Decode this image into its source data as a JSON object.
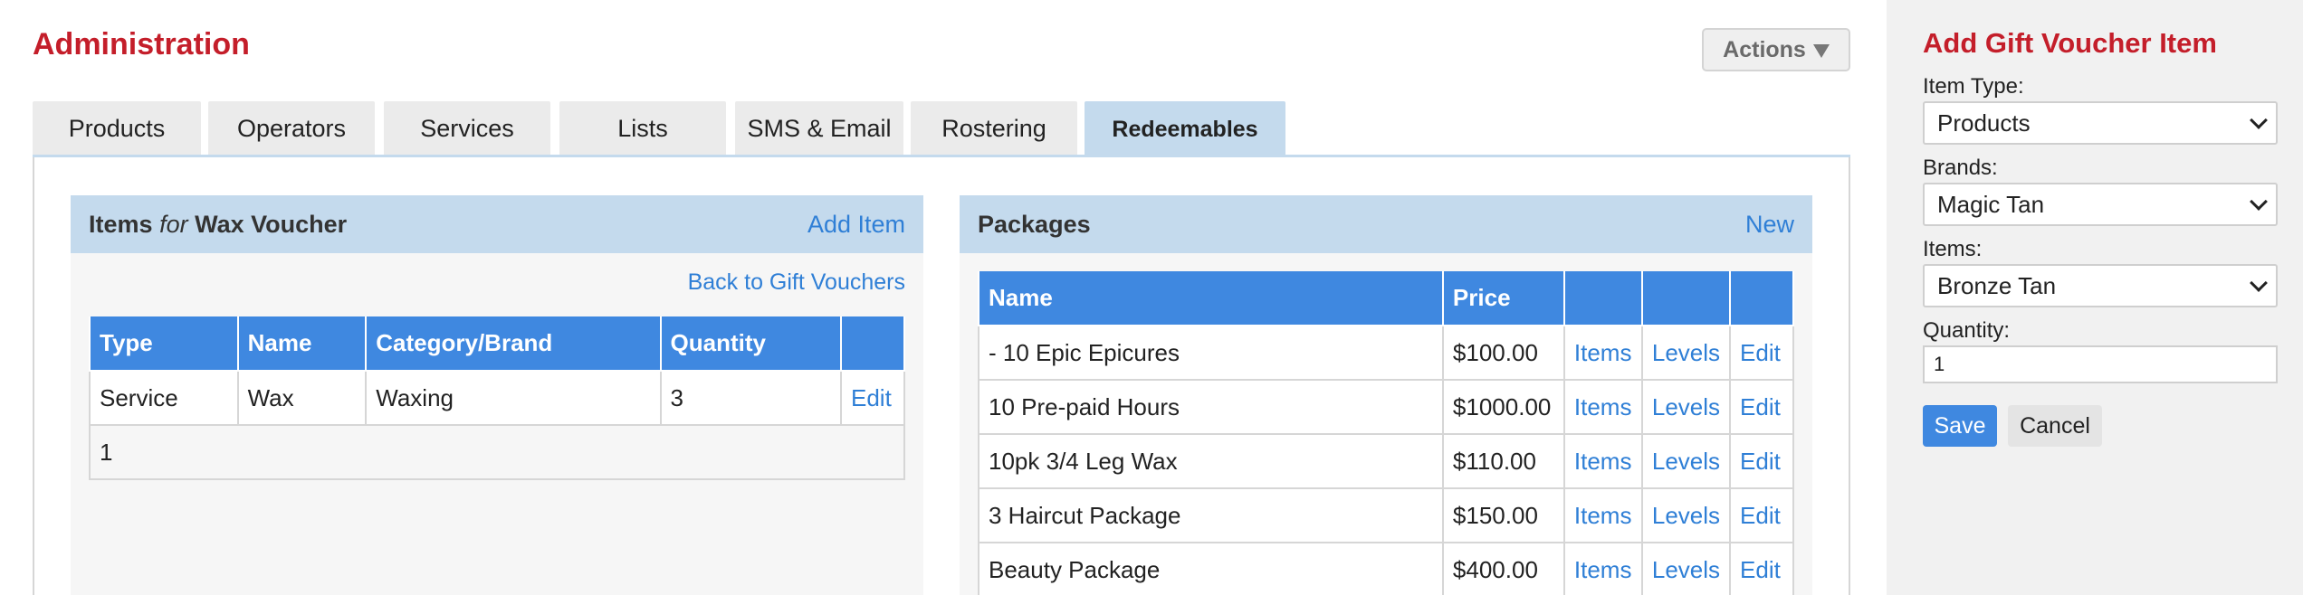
{
  "header": {
    "title": "Administration",
    "actions_label": "Actions"
  },
  "tabs": [
    {
      "label": "Products"
    },
    {
      "label": "Operators"
    },
    {
      "label": "Services"
    },
    {
      "label": "Lists"
    },
    {
      "label": "SMS & Email"
    },
    {
      "label": "Rostering"
    },
    {
      "label": "Redeemables",
      "active": true
    }
  ],
  "items_panel": {
    "title_prefix": "Items",
    "title_for": "for",
    "title_name": "Wax Voucher",
    "add_link": "Add Item",
    "back_link": "Back to Gift Vouchers",
    "columns": [
      "Type",
      "Name",
      "Category/Brand",
      "Quantity",
      ""
    ],
    "rows": [
      {
        "type": "Service",
        "name": "Wax",
        "category": "Waxing",
        "quantity": "3",
        "action": "Edit"
      }
    ],
    "footer": "1"
  },
  "packages_panel": {
    "title": "Packages",
    "new_link": "New",
    "columns": [
      "Name",
      "Price",
      "",
      "",
      ""
    ],
    "rows": [
      {
        "name": "- 10 Epic Epicures",
        "price": "$100.00",
        "items": "Items",
        "levels": "Levels",
        "edit": "Edit"
      },
      {
        "name": "10 Pre-paid Hours",
        "price": "$1000.00",
        "items": "Items",
        "levels": "Levels",
        "edit": "Edit"
      },
      {
        "name": "10pk 3/4 Leg Wax",
        "price": "$110.00",
        "items": "Items",
        "levels": "Levels",
        "edit": "Edit"
      },
      {
        "name": "3 Haircut Package",
        "price": "$150.00",
        "items": "Items",
        "levels": "Levels",
        "edit": "Edit"
      },
      {
        "name": "Beauty Package",
        "price": "$400.00",
        "items": "Items",
        "levels": "Levels",
        "edit": "Edit"
      }
    ]
  },
  "sidebar": {
    "title": "Add Gift Voucher Item",
    "item_type_label": "Item Type:",
    "item_type_value": "Products",
    "brands_label": "Brands:",
    "brands_value": "Magic Tan",
    "items_label": "Items:",
    "items_value": "Bronze Tan",
    "quantity_label": "Quantity:",
    "quantity_value": "1",
    "save_label": "Save",
    "cancel_label": "Cancel"
  },
  "colors": {
    "brand_red": "#c41e2a",
    "header_blue": "#3f88e0",
    "panel_head": "#c4daed",
    "link_blue": "#2f7fd6"
  }
}
